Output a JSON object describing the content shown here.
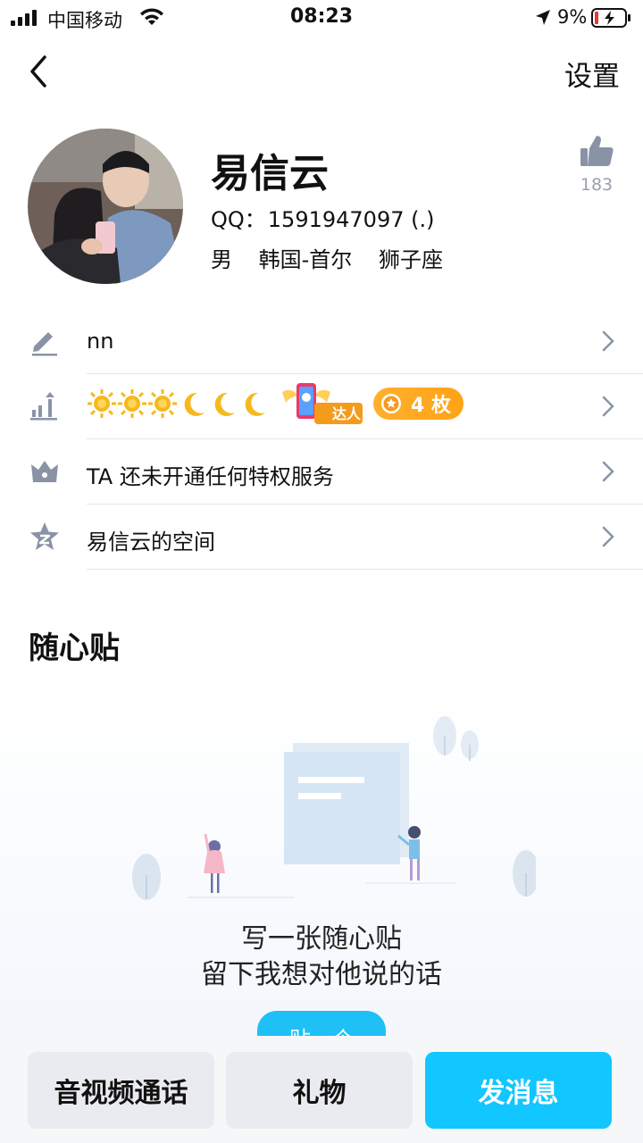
{
  "status_bar": {
    "carrier": "中国移动",
    "time": "08:23",
    "battery_pct": "9%"
  },
  "nav": {
    "settings_label": "设置"
  },
  "profile": {
    "name": "易信云",
    "qq_label": "QQ：",
    "qq_value": "1591947097 (.)",
    "gender": "男",
    "location": "韩国-首尔",
    "zodiac": "狮子座",
    "like_count": "183"
  },
  "info_rows": {
    "signature": "nn",
    "medal_count": "4 枚",
    "talent_label": "达人",
    "privilege": "TA 还未开通任何特权服务",
    "space": "易信云的空间"
  },
  "section": {
    "title": "随心贴",
    "empty_line1": "写一张随心贴",
    "empty_line2": "留下我想对他说的话",
    "post_button": "贴一个"
  },
  "actions": {
    "call": "音视频通话",
    "gift": "礼物",
    "message": "发消息"
  },
  "colors": {
    "accent": "#12c6ff",
    "medal": "#ffa215",
    "icon_gray": "#8a93a6"
  }
}
